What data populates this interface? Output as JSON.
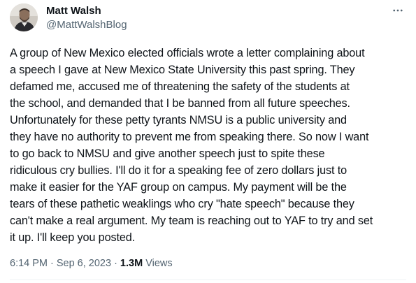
{
  "author": {
    "display_name": "Matt Walsh",
    "handle": "@MattWalshBlog",
    "avatar_icon": "profile-photo"
  },
  "more_icon": "more-horizontal-icon",
  "tweet": {
    "text": "A group of New Mexico elected officials wrote a letter complaining about\na speech I gave at New Mexico State University this past spring. They\ndefamed me, accused me of threatening the safety of the students at\nthe school, and demanded that I be banned from all future speeches.\nUnfortunately for these petty tyrants NMSU is a public university and\nthey have no authority to prevent me from speaking there. So now I want\nto go back to NMSU and give another speech just to spite these\nridiculous cry bullies. I'll do it for a speaking fee of zero dollars just to\nmake it easier for the YAF group on campus. My payment will be the\ntears of these pathetic weaklings who cry \"hate speech\" because they\ncan't make a real argument. My team is reaching out to YAF to try and set\nit up. I'll keep you posted."
  },
  "meta": {
    "time": "6:14 PM",
    "separator": "·",
    "date": "Sep 6, 2023",
    "views_count": "1.3M",
    "views_label": "Views"
  },
  "colors": {
    "text_primary": "#0f1419",
    "text_secondary": "#536471",
    "divider": "#eff3f4"
  }
}
